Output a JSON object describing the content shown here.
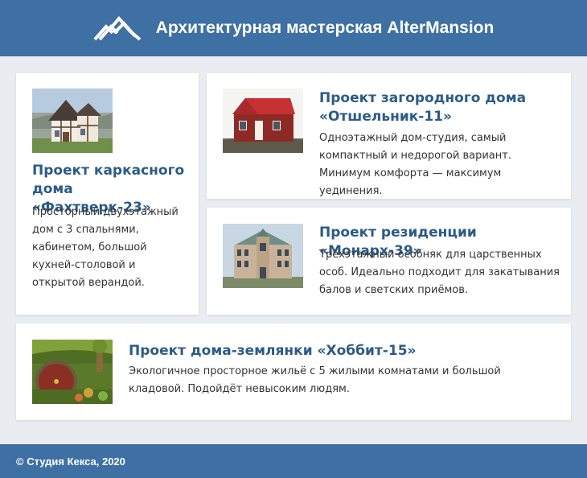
{
  "header": {
    "title": "Архитектурная мастерская AlterMansion",
    "logo_icon": "mountains-logo-icon"
  },
  "projects": [
    {
      "title": "Проект каркасного дома «Фахтверк-23»",
      "description": "Просторный двухэтажный дом с 3 спальнями, кабинетом, большой кухней-столовой и открытой верандой.",
      "image": "timber-frame-house-photo"
    },
    {
      "title": "Проект загородного дома «Отшельник-11»",
      "description": "Одноэтажный дом-студия, самый компактный и недорогой вариант. Минимум комфорта — максимум уединения.",
      "image": "red-cabin-photo"
    },
    {
      "title": "Проект резиденции «Монарх-39»",
      "description": "Трёхэтажный особняк для царственных особ. Идеально подходит для закатывания балов и светских приёмов.",
      "image": "mansion-photo"
    },
    {
      "title": "Проект дома-землянки «Хоббит-15»",
      "description": "Экологичное просторное жильё с 5 жилыми комнатами и большой кладовой. Подойдёт невысоким людям.",
      "image": "hobbit-hole-photo"
    }
  ],
  "footer": {
    "copyright": "© Студия Кекса, 2020"
  },
  "colors": {
    "brand": "#3e70a3",
    "title": "#2b5b88",
    "background": "#e9edf1",
    "card": "#ffffff"
  }
}
